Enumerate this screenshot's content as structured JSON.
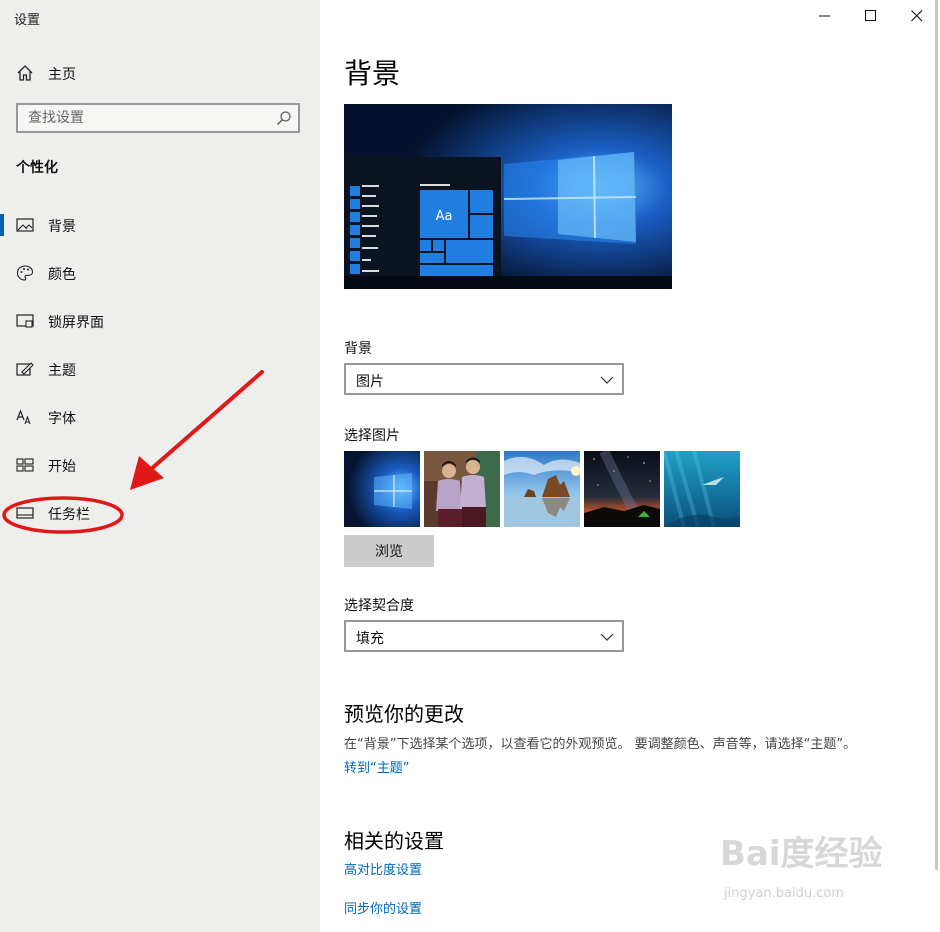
{
  "window": {
    "title": "设置"
  },
  "sidebar": {
    "home_label": "主页",
    "search_placeholder": "查找设置",
    "section_title": "个性化",
    "items": [
      {
        "label": "背景",
        "icon": "picture-icon",
        "active": true
      },
      {
        "label": "颜色",
        "icon": "palette-icon"
      },
      {
        "label": "锁屏界面",
        "icon": "lock-screen-icon"
      },
      {
        "label": "主题",
        "icon": "theme-icon"
      },
      {
        "label": "字体",
        "icon": "font-icon"
      },
      {
        "label": "开始",
        "icon": "start-icon"
      },
      {
        "label": "任务栏",
        "icon": "taskbar-icon"
      }
    ]
  },
  "main": {
    "title": "背景",
    "preview_tile_text": "Aa",
    "background": {
      "label": "背景",
      "value": "图片"
    },
    "choose_picture": {
      "label": "选择图片",
      "browse_label": "浏览"
    },
    "fit": {
      "label": "选择契合度",
      "value": "填充"
    },
    "preview_changes": {
      "title": "预览你的更改",
      "description": "在“背景”下选择某个选项，以查看它的外观预览。 要调整颜色、声音等，请选择“主题”。",
      "link": "转到“主题”"
    },
    "related": {
      "title": "相关的设置",
      "links": [
        "高对比度设置",
        "同步你的设置"
      ]
    }
  },
  "watermark": {
    "line1": "Bai度经验",
    "line2": "jingyan.baidu.com"
  },
  "colors": {
    "accent": "#0063b1",
    "link": "#0067b8",
    "annotation": "#e01818"
  }
}
